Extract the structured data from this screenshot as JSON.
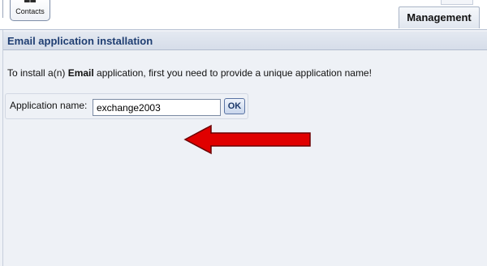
{
  "toolbar": {
    "contacts_label": "Contacts"
  },
  "tabs": {
    "management_label": "Management"
  },
  "section": {
    "title": "Email application installation",
    "intro_before": "To install a(n) ",
    "intro_bold": "Email",
    "intro_after": " application, first you need to provide a unique application name!"
  },
  "form": {
    "name_label": "Application name:",
    "name_value": "exchange2003",
    "ok_label": "OK"
  },
  "annotation": {
    "arrow_color": "#e00000",
    "icon": "arrow-left-icon"
  },
  "colors": {
    "title_text": "#1f3e72",
    "panel_bg": "#eef1f6"
  }
}
